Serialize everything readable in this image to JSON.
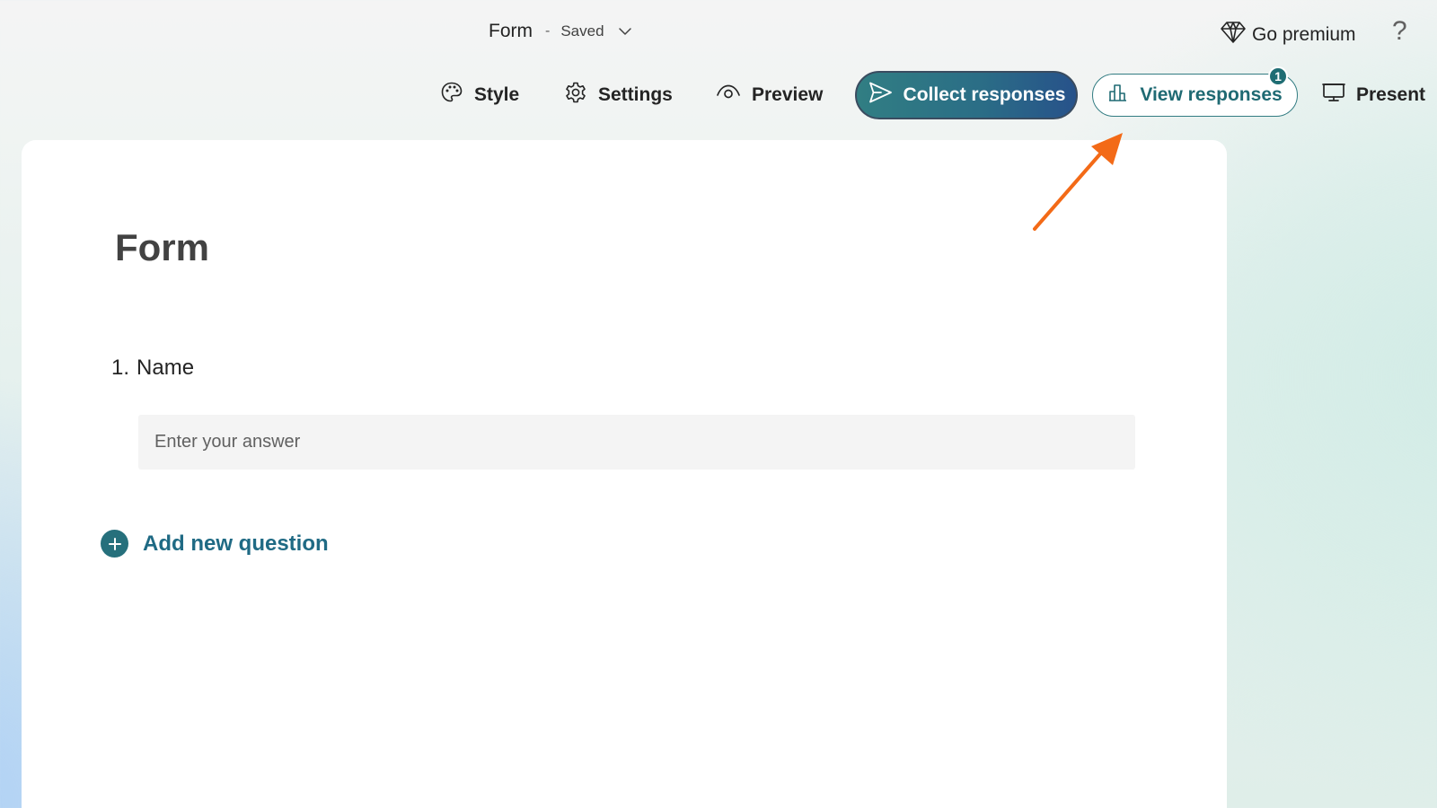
{
  "header": {
    "title": "Form",
    "separator": "-",
    "status": "Saved",
    "premium_label": "Go premium",
    "help_label": "?"
  },
  "toolbar": {
    "style_label": "Style",
    "settings_label": "Settings",
    "preview_label": "Preview",
    "collect_label": "Collect responses",
    "view_label": "View responses",
    "view_badge": "1",
    "present_label": "Present"
  },
  "form": {
    "title": "Form",
    "questions": [
      {
        "number": "1.",
        "label": "Name",
        "placeholder": "Enter your answer"
      }
    ],
    "add_question_label": "Add new question"
  },
  "icons": {
    "style": "palette-icon",
    "settings": "gear-icon",
    "preview": "eye-icon",
    "collect": "send-icon",
    "view": "bar-chart-icon",
    "present": "monitor-icon",
    "premium": "diamond-icon",
    "add": "plus-circle-icon"
  },
  "colors": {
    "accent": "#26707c",
    "annotation_arrow": "#f36a17"
  }
}
